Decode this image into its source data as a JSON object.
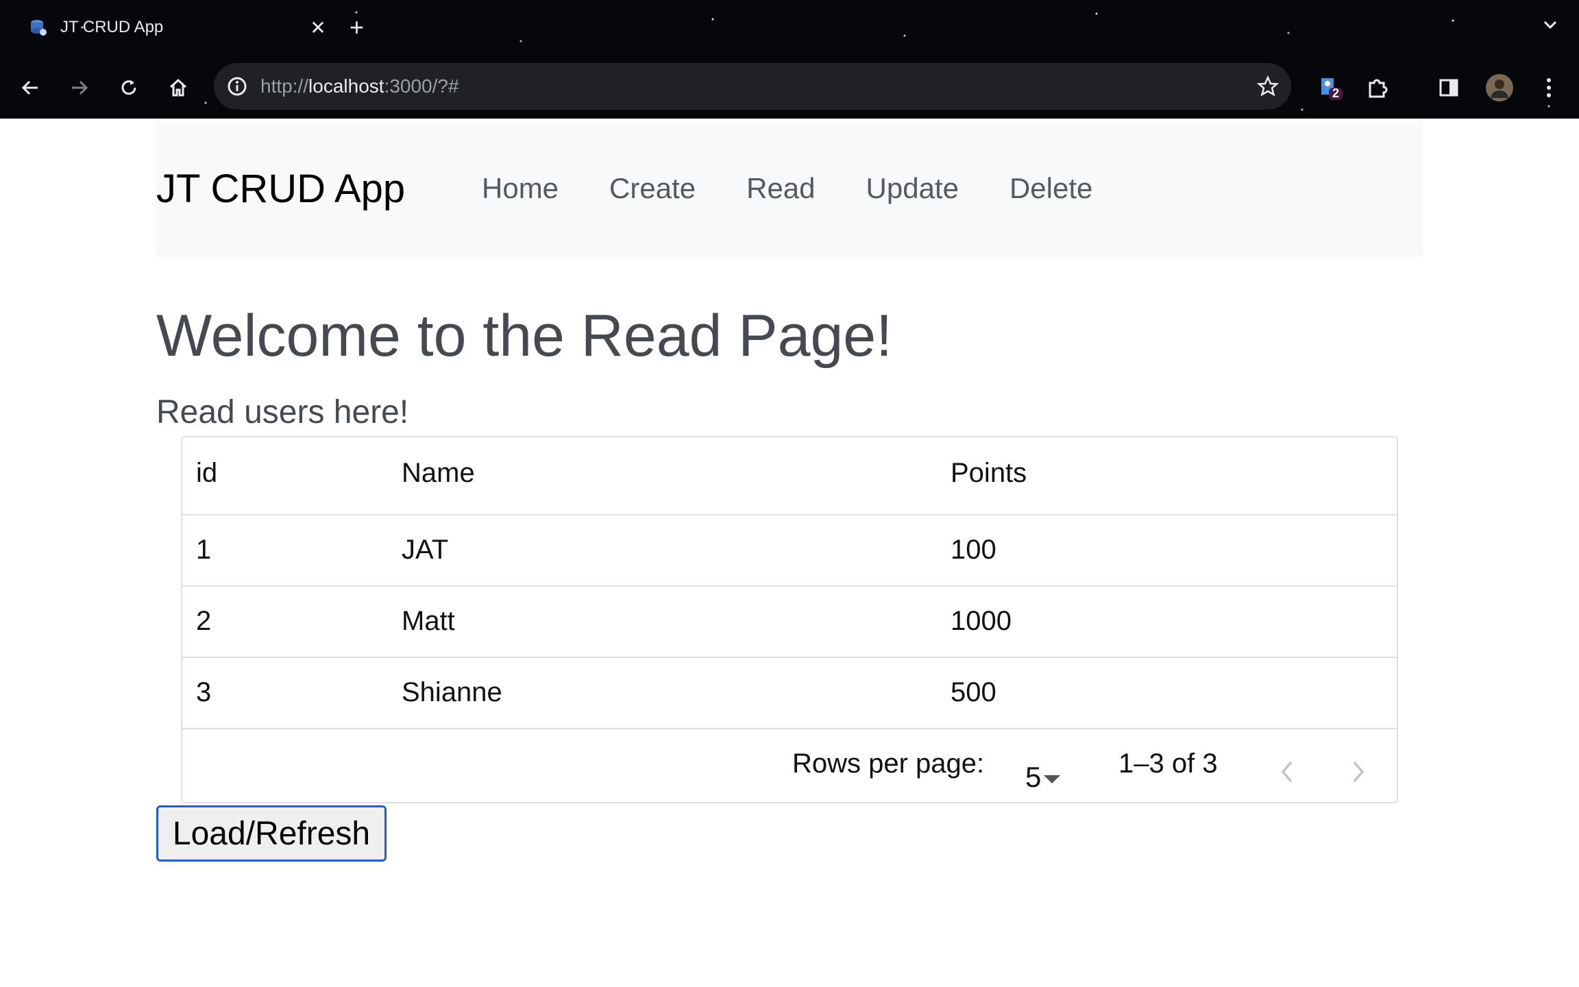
{
  "browser": {
    "tab_title": "JT CRUD App",
    "url_prefix": "http://",
    "url_host": "localhost",
    "url_rest": ":3000/?#",
    "extension_badge": "2",
    "icons": [
      "back-icon",
      "forward-icon",
      "reload-icon",
      "home-icon",
      "site-info-icon",
      "bookmark-star-icon",
      "extension-icon",
      "puzzle-icon",
      "side-panel-icon",
      "profile-avatar",
      "menu-icon"
    ]
  },
  "navbar": {
    "brand": "JT CRUD App",
    "links": [
      "Home",
      "Create",
      "Read",
      "Update",
      "Delete"
    ]
  },
  "page": {
    "title": "Welcome to the Read Page!",
    "subtitle": "Read users here!"
  },
  "table": {
    "headers": [
      "id",
      "Name",
      "Points"
    ],
    "rows": [
      {
        "id": "1",
        "name": "JAT",
        "points": "100"
      },
      {
        "id": "2",
        "name": "Matt",
        "points": "1000"
      },
      {
        "id": "3",
        "name": "Shianne",
        "points": "500"
      }
    ],
    "pagination": {
      "rows_per_page_label": "Rows per page:",
      "rows_per_page_value": "5",
      "range": "1–3 of 3"
    }
  },
  "actions": {
    "load_refresh": "Load/Refresh"
  },
  "colors": {
    "accent_border": "#1f5fd0",
    "navbar_bg": "#f8f9fa",
    "heading": "#454a50"
  }
}
